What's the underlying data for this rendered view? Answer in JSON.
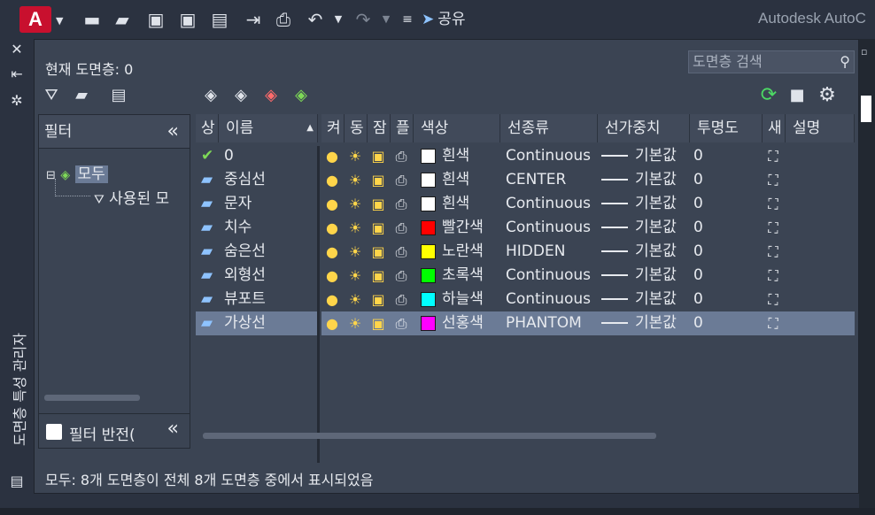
{
  "quick_access": {
    "logo": "A",
    "share_label": "공유",
    "app_title": "Autodesk AutoC"
  },
  "palette": {
    "title": "도면층 특성 관리자"
  },
  "panel": {
    "current_layer": "현재 도면층: 0",
    "search_placeholder": "도면층 검색",
    "status": "모두: 8개 도면층이 전체 8개 도면층 중에서 표시되었음"
  },
  "filters": {
    "header": "필터",
    "collapse": "«",
    "tree": [
      {
        "label": "모두"
      },
      {
        "label": "사용된 모"
      }
    ],
    "invert_label": "필터 반전("
  },
  "columns": [
    "상",
    "이름",
    "켜",
    "동",
    "잠",
    "플",
    "색상",
    "선종류",
    "선가중치",
    "투명도",
    "새",
    "설명"
  ],
  "layers": [
    {
      "name": "0",
      "color_name": "흰색",
      "color": "#ffffff",
      "linetype": "Continuous",
      "lineweight": "기본값",
      "transparency": "0",
      "current": true
    },
    {
      "name": "중심선",
      "color_name": "흰색",
      "color": "#ffffff",
      "linetype": "CENTER",
      "lineweight": "기본값",
      "transparency": "0",
      "current": false
    },
    {
      "name": "문자",
      "color_name": "흰색",
      "color": "#ffffff",
      "linetype": "Continuous",
      "lineweight": "기본값",
      "transparency": "0",
      "current": false
    },
    {
      "name": "치수",
      "color_name": "빨간색",
      "color": "#ff0000",
      "linetype": "Continuous",
      "lineweight": "기본값",
      "transparency": "0",
      "current": false
    },
    {
      "name": "숨은선",
      "color_name": "노란색",
      "color": "#ffff00",
      "linetype": "HIDDEN",
      "lineweight": "기본값",
      "transparency": "0",
      "current": false
    },
    {
      "name": "외형선",
      "color_name": "초록색",
      "color": "#00ff00",
      "linetype": "Continuous",
      "lineweight": "기본값",
      "transparency": "0",
      "current": false
    },
    {
      "name": "뷰포트",
      "color_name": "하늘색",
      "color": "#00ffff",
      "linetype": "Continuous",
      "lineweight": "기본값",
      "transparency": "0",
      "current": false
    },
    {
      "name": "가상선",
      "color_name": "선홍색",
      "color": "#ff00ff",
      "linetype": "PHANTOM",
      "lineweight": "기본값",
      "transparency": "0",
      "current": false,
      "selected": true
    }
  ]
}
